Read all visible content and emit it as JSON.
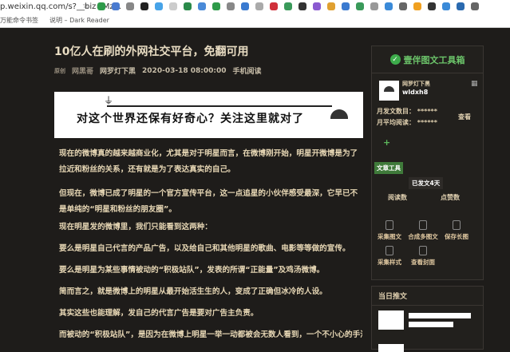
{
  "browser": {
    "url": "p.weixin.qq.com/s?__biz=Mz...",
    "bookmarks": [
      "万能命令书签",
      "说明 – Dark Reader"
    ],
    "extension_colors": [
      "#2e9b4a",
      "#4a7bd0",
      "#888",
      "#222",
      "#47a3e8",
      "#ccc",
      "#2a8a4a",
      "#4a8ad8",
      "#2e9b4a",
      "#888",
      "#3a7ad0",
      "#aaa",
      "#d0303a",
      "#3a9a5a",
      "#333",
      "#8a5ad0",
      "#e0a030",
      "#3a7ad0",
      "#3a9a5a",
      "#999",
      "#3a8ad8",
      "#666",
      "#f0a020",
      "#333",
      "#3a8ad8",
      "#2a6ab0",
      "#666"
    ]
  },
  "article": {
    "title": "10亿人在刷的外网社交平台，免翻可用",
    "meta": {
      "label": "原创",
      "author": "网黑哥",
      "account": "网罗灯下黑",
      "date": "2020-03-18 08:00:00",
      "mobile_read": "手机阅读"
    },
    "banner_text": "对这个世界还保有好奇心？关注这里就对了",
    "paragraphs": [
      "现在的微博真的越来越商业化，尤其是对于明星而言，在微博刚开始，明星开微博是为了拉近和粉丝的关系，还有就是为了表达真实的自己。",
      "但现在，微博已成了明星的一个官方宣传平台，这一点追星的小伙伴感受最深，它早已不是单纯的“明星和粉丝的朋友圈”。",
      "现在明星发的微博里，我们只能看到这两种：",
      "要么是明星自己代言的产品广告，以及给自己和其他明星的歌曲、电影等等做的宣传。",
      "要么是明星为某些事情被动的“积极站队”，发表的所谓“正能量”及鸡汤微博。",
      "简而言之，就是微博上的明星从最开始活生生的人，变成了正确但冰冷的人设。",
      "其实这些也能理解，发自己的代言广告是要对广告主负责。",
      "而被动的“积极站队”，是因为在微博上明星一举一动都被会无数人看到，一个不小心的手滑点"
    ]
  },
  "sidebar": {
    "title": "壹伴图文工具箱",
    "account_name": "网罗灯下黑",
    "account_id": "wldxh8",
    "monthly_posts_label": "月发文数目：",
    "monthly_posts": "******",
    "monthly_reads_label": "月平均阅读：",
    "monthly_reads": "******",
    "view": "查看",
    "tag": "文章工具",
    "days": "已发文4天",
    "reads": "阅读数",
    "likes": "点赞数",
    "tools": [
      "采集图文",
      "合成多图文",
      "保存长图",
      "采集样式",
      "查看封面"
    ]
  },
  "today": {
    "title": "当日推文"
  }
}
